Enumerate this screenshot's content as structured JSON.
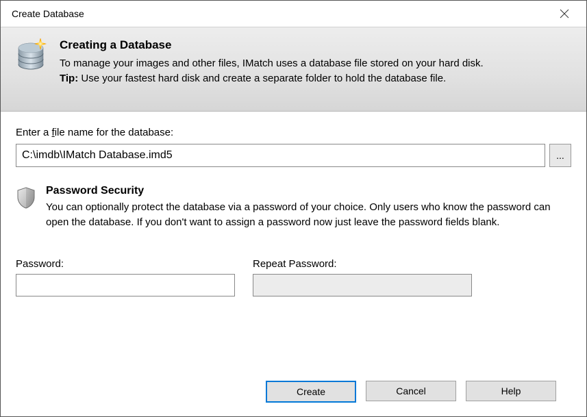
{
  "window": {
    "title": "Create Database"
  },
  "header": {
    "heading": "Creating a Database",
    "body": "To manage your images and other files, IMatch uses a database file stored on your hard disk.",
    "tip_label": "Tip:",
    "tip_body": " Use your fastest hard disk and create a separate folder to hold the database file."
  },
  "file": {
    "label_pre": "Enter a ",
    "label_ul": "f",
    "label_post": "ile name for the database:",
    "value": "C:\\imdb\\IMatch Database.imd5",
    "browse_label": "..."
  },
  "password": {
    "heading": "Password Security",
    "desc": "You can optionally protect the database via a password of your choice. Only users who know the password can open the database. If you don't want to assign a password now just leave the password fields blank.",
    "pw_label": "Password:",
    "repeat_label": "Repeat Password:",
    "pw_value": "",
    "repeat_value": ""
  },
  "buttons": {
    "create": "Create",
    "cancel": "Cancel",
    "help": "Help"
  }
}
